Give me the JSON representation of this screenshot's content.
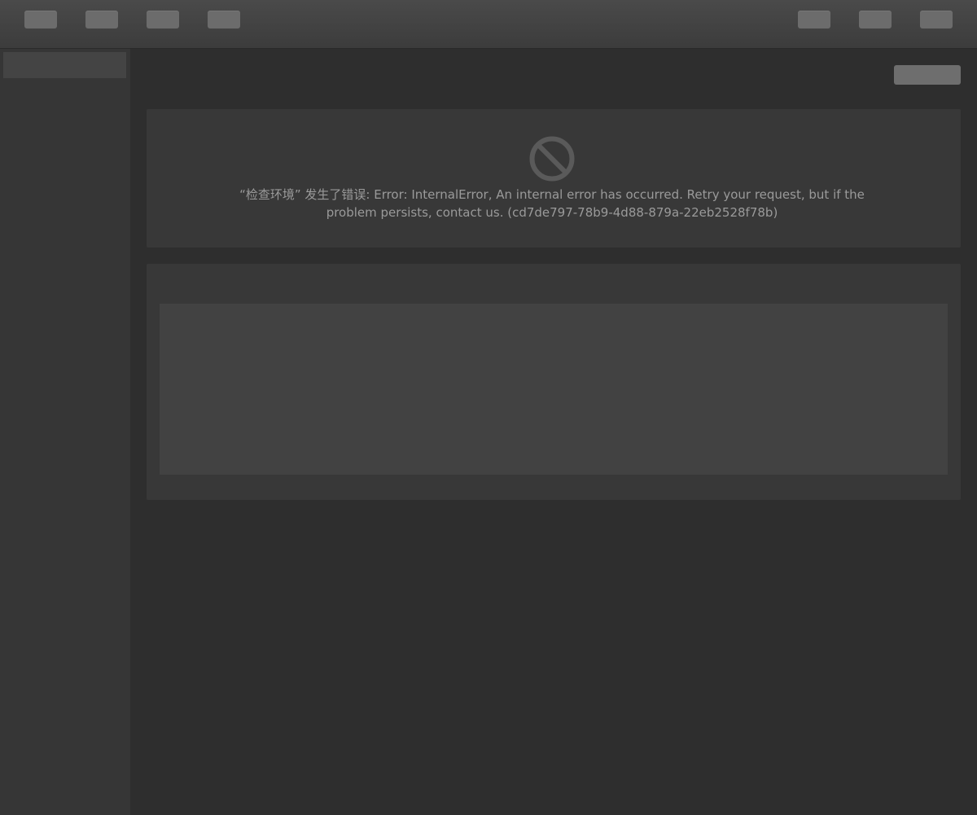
{
  "toolbar": {
    "left_buttons": [
      "button-1",
      "button-2",
      "button-3",
      "button-4"
    ],
    "right_buttons": [
      "button-5",
      "button-6",
      "button-7"
    ]
  },
  "error": {
    "icon": "prohibited-icon",
    "message": "“检查环境” 发生了错误: Error: InternalError, An internal error has occurred. Retry your request, but if the problem persists, contact us. (cd7de797-78b9-4d88-879a-22eb2528f78b)"
  },
  "colors": {
    "background": "#2e2e2e",
    "topbar": "#444444",
    "sidebar": "#363636",
    "panel": "#383838",
    "button": "#6c6c6c",
    "error_text": "#9a9a9a",
    "error_icon": "#5a5a5a"
  }
}
